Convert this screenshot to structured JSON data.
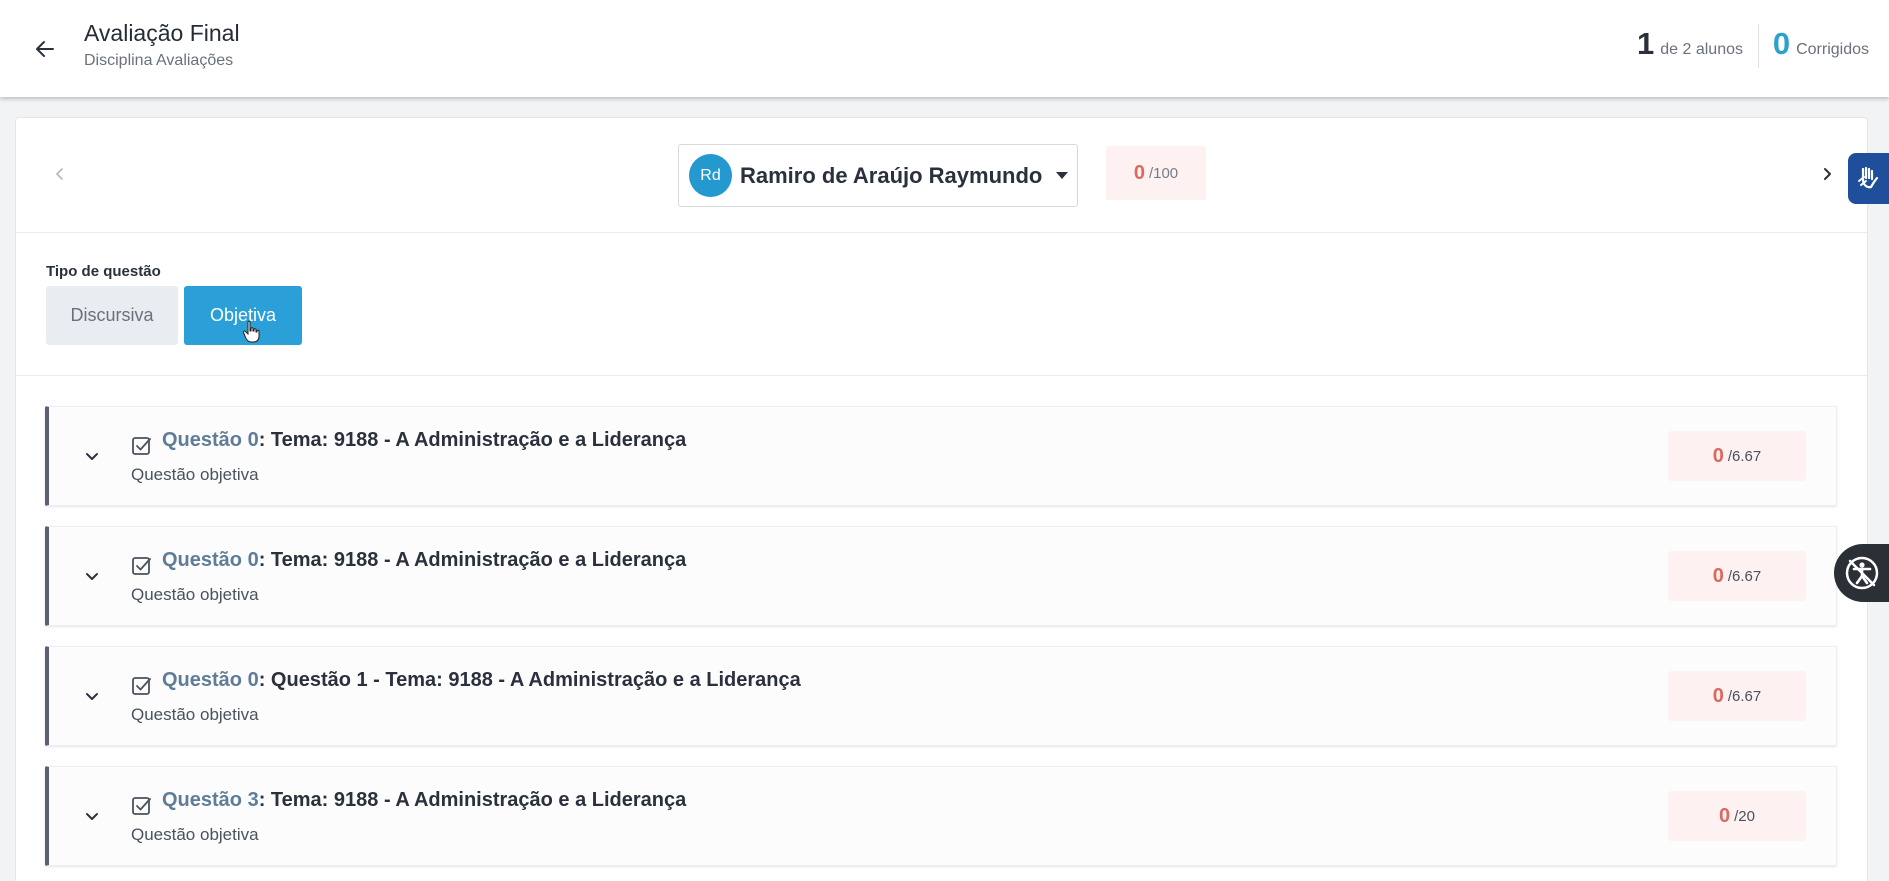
{
  "header": {
    "title": "Avaliação Final",
    "subtitle": "Disciplina Avaliações",
    "progress": {
      "current": "1",
      "label": "de 2 alunos"
    },
    "corrected": {
      "count": "0",
      "label": "Corrigidos"
    }
  },
  "student": {
    "initials": "Rd",
    "name": "Ramiro de Araújo Raymundo",
    "score": "0",
    "max": "/100"
  },
  "question_type": {
    "label": "Tipo de questão",
    "options": [
      "Discursiva",
      "Objetiva"
    ],
    "selected": "Objetiva"
  },
  "questions": [
    {
      "num": "Questão 0",
      "title": ": Tema: 9188 - A Administração e a Liderança",
      "subtitle": "Questão objetiva",
      "score": "0",
      "max": "/6.67"
    },
    {
      "num": "Questão 0",
      "title": ": Tema: 9188 - A Administração e a Liderança",
      "subtitle": "Questão objetiva",
      "score": "0",
      "max": "/6.67"
    },
    {
      "num": "Questão 0",
      "title": ": Questão 1 - Tema: 9188 - A Administração e a Liderança",
      "subtitle": "Questão objetiva",
      "score": "0",
      "max": "/6.67"
    },
    {
      "num": "Questão 3",
      "title": ": Tema: 9188 - A Administração e a Liderança",
      "subtitle": "Questão objetiva",
      "score": "0",
      "max": "/20"
    }
  ],
  "icons": {
    "back": "arrow-left-icon",
    "prev": "chevron-left-icon",
    "next": "chevron-right-icon",
    "expand": "chevron-down-icon",
    "question": "checkbox-checked-icon",
    "libras": "sign-language-icon",
    "accessibility": "accessibility-icon"
  },
  "colors": {
    "accent": "#2a9fd8",
    "score": "#d86a5e",
    "corrected": "#2aa1cf",
    "question_number": "#5f7d97"
  }
}
